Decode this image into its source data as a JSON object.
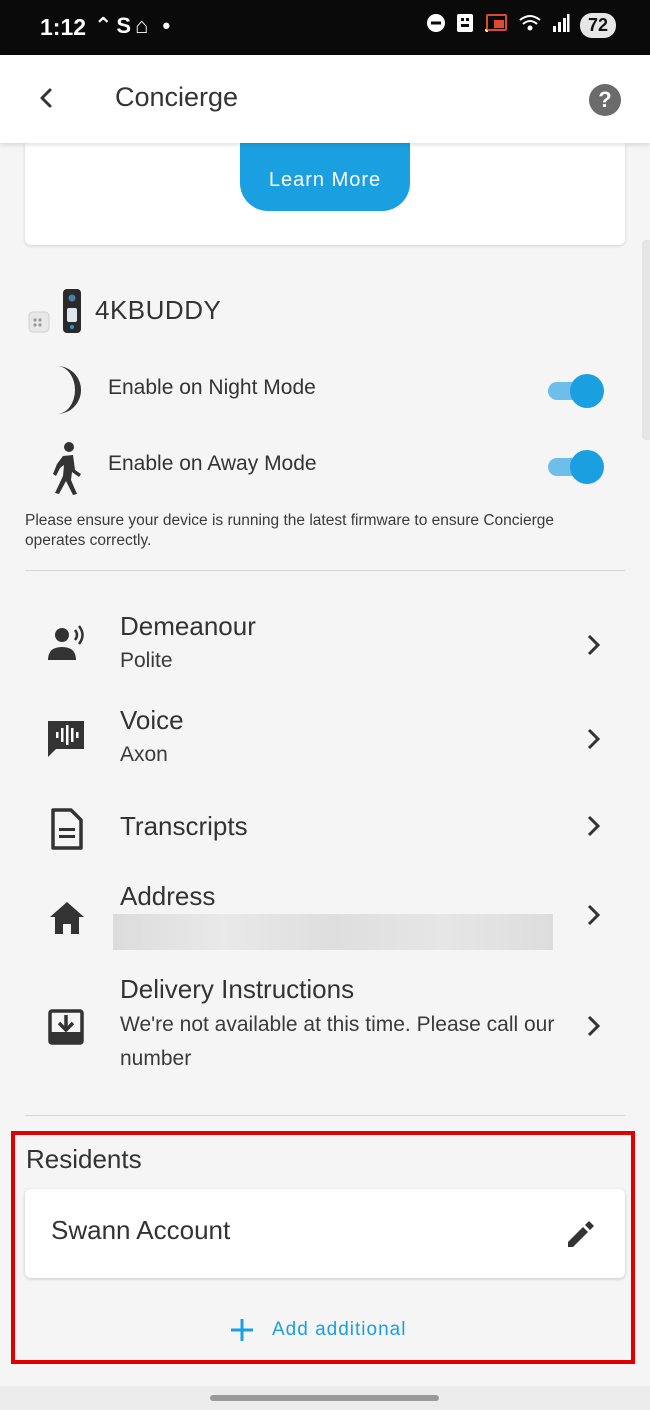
{
  "status_bar": {
    "time": "1:12",
    "left_icons": "⌃S⌂ •",
    "battery": "72"
  },
  "header": {
    "title": "Concierge",
    "help_icon": "?"
  },
  "promo": {
    "button_label": "Learn More"
  },
  "device": {
    "name": "4KBUDDY",
    "modes": [
      {
        "label": "Enable on Night Mode",
        "icon": "moon-icon",
        "enabled": true
      },
      {
        "label": "Enable on Away Mode",
        "icon": "walking-person-icon",
        "enabled": true
      }
    ],
    "firmware_note": "Please ensure your device is running the latest firmware to ensure Concierge operates correctly."
  },
  "settings": [
    {
      "title": "Demeanour",
      "value": "Polite",
      "icon": "speaking-person-icon"
    },
    {
      "title": "Voice",
      "value": "Axon",
      "icon": "voice-chat-icon"
    },
    {
      "title": "Transcripts",
      "value": "",
      "icon": "document-icon"
    },
    {
      "title": "Address",
      "value": "",
      "icon": "home-icon"
    },
    {
      "title": "Delivery Instructions",
      "value": "We're not available at this time. Please call our number",
      "icon": "package-inbox-icon"
    }
  ],
  "residents": {
    "title": "Residents",
    "items": [
      {
        "name": "Swann Account"
      }
    ],
    "add_label": "Add additional"
  },
  "colors": {
    "accent": "#1a9fe0",
    "toggle_track": "#6dbfe9",
    "highlight_border": "#e00000"
  }
}
